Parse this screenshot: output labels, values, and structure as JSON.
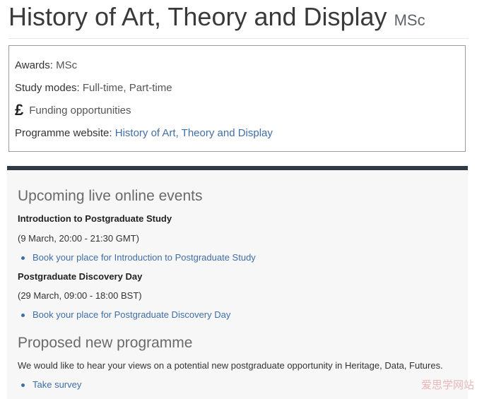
{
  "header": {
    "title": "History of Art, Theory and Display",
    "award_suffix": "MSc"
  },
  "key_info": {
    "awards_label": "Awards:",
    "awards_value": "MSc",
    "study_modes_label": "Study modes:",
    "study_modes_value": "Full-time, Part-time",
    "funding_icon": "pound-icon",
    "funding_label": "Funding opportunities",
    "website_label": "Programme website:",
    "website_link": "History of Art, Theory and Display"
  },
  "events": {
    "heading": "Upcoming live online events",
    "items": [
      {
        "title": "Introduction to Postgraduate Study",
        "time": "(9 March, 20:00 - 21:30 GMT)",
        "link": "Book your place for Introduction to Postgraduate Study"
      },
      {
        "title": "Postgraduate Discovery Day",
        "time": "(29 March, 09:00 - 18:00 BST)",
        "link": "Book your place for Postgraduate Discovery Day"
      }
    ]
  },
  "proposed": {
    "heading": "Proposed new programme",
    "text": "We would like to hear your views on a potential new postgraduate opportunity in Heritage, Data, Futures.",
    "link": "Take survey"
  },
  "watermark": "爱思学网站",
  "colors": {
    "link": "#3e6ea8",
    "panel_border": "#2f3a45",
    "panel_bg": "#f7f7f7"
  }
}
